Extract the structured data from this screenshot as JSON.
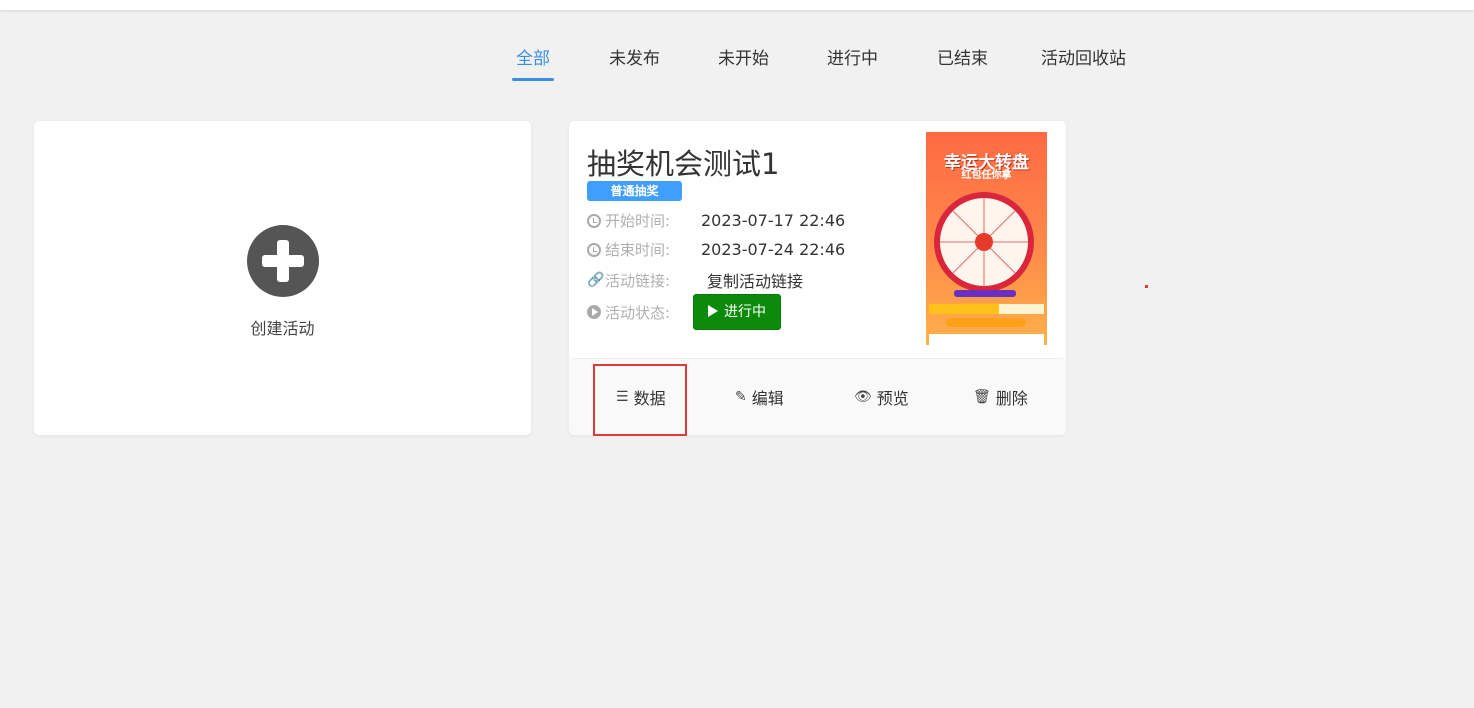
{
  "tabs": [
    {
      "label": "全部",
      "active": true
    },
    {
      "label": "未发布",
      "active": false
    },
    {
      "label": "未开始",
      "active": false
    },
    {
      "label": "进行中",
      "active": false
    },
    {
      "label": "已结束",
      "active": false
    },
    {
      "label": "活动回收站",
      "active": false
    }
  ],
  "create_card": {
    "label": "创建活动",
    "icon": "plus-circle-icon"
  },
  "activity": {
    "title": "抽奖机会测试1",
    "type_badge": "普通抽奖",
    "start_label": "开始时间:",
    "start_value": "2023-07-17 22:46",
    "end_label": "结束时间:",
    "end_value": "2023-07-24 22:46",
    "link_label": "活动链接:",
    "link_value": "复制活动链接",
    "status_label": "活动状态:",
    "status_value": "进行中",
    "status_color": "#0c8a0c",
    "poster": {
      "title": "幸运大转盘",
      "subtitle": "红包任你拿"
    },
    "actions": {
      "data": "数据",
      "edit": "编辑",
      "preview": "预览",
      "delete": "删除"
    }
  },
  "colors": {
    "accent": "#3a8ee6",
    "badge": "#409eff",
    "highlight": "#e03a3a"
  }
}
